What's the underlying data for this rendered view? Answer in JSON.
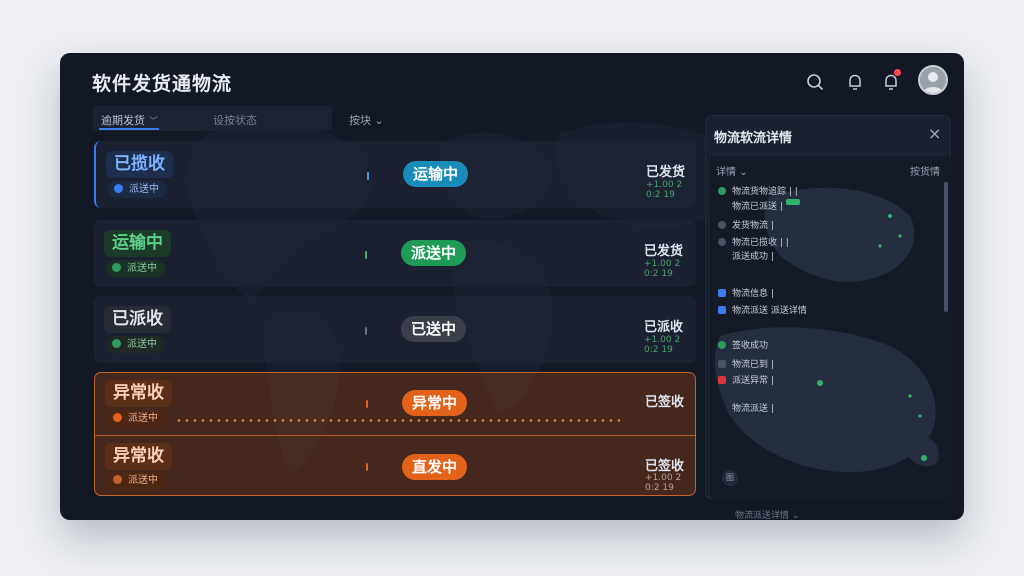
{
  "app": {
    "title": "软件发货通物流"
  },
  "filter": {
    "select_label": "逾期发货",
    "input_placeholder": "设按状态",
    "sort_label": "按块"
  },
  "rows": [
    {
      "title": "已揽收",
      "sub": "派送中",
      "status": "运输中",
      "right_title": "已发货",
      "right_sub": "+1.00 2 0:2 19"
    },
    {
      "title": "运输中",
      "sub": "派送中",
      "status": "派送中",
      "right_title": "已发货",
      "right_sub": "+1.00 2 0:2 19"
    },
    {
      "title": "已派收",
      "sub": "派送中",
      "status": "已送中",
      "right_title": "已派收",
      "right_sub": "+1.00 2 0:2 19"
    },
    {
      "title": "异常收",
      "sub": "派送中",
      "status": "异常中",
      "right_title": "已签收",
      "right_sub": ""
    },
    {
      "title": "异常收",
      "sub": "派送中",
      "status": "直发中",
      "right_title": "已签收",
      "right_sub": "+1.00 2 0:2 19"
    }
  ],
  "panel": {
    "title": "物流软流详情",
    "close": "×",
    "tab_left": "详情",
    "tab_right": "按货情",
    "events": [
      "物流货物追踪  |  |",
      "物流已派送  |",
      "发货物流  |",
      "物流已揽收  |  |",
      "派送成功  |",
      "物流信息  |",
      "物流派送  派送详情",
      "签收成功",
      "物流已到  |",
      "派送异常  |",
      "物流派送  |"
    ],
    "legend": "图",
    "footer": "物流派送详情"
  },
  "colors": {
    "accent": "#3c7cf0",
    "transit": "#1a8cba",
    "delivering": "#1f9b55",
    "delivered": "#3a3f49",
    "exception": "#e2621a"
  }
}
